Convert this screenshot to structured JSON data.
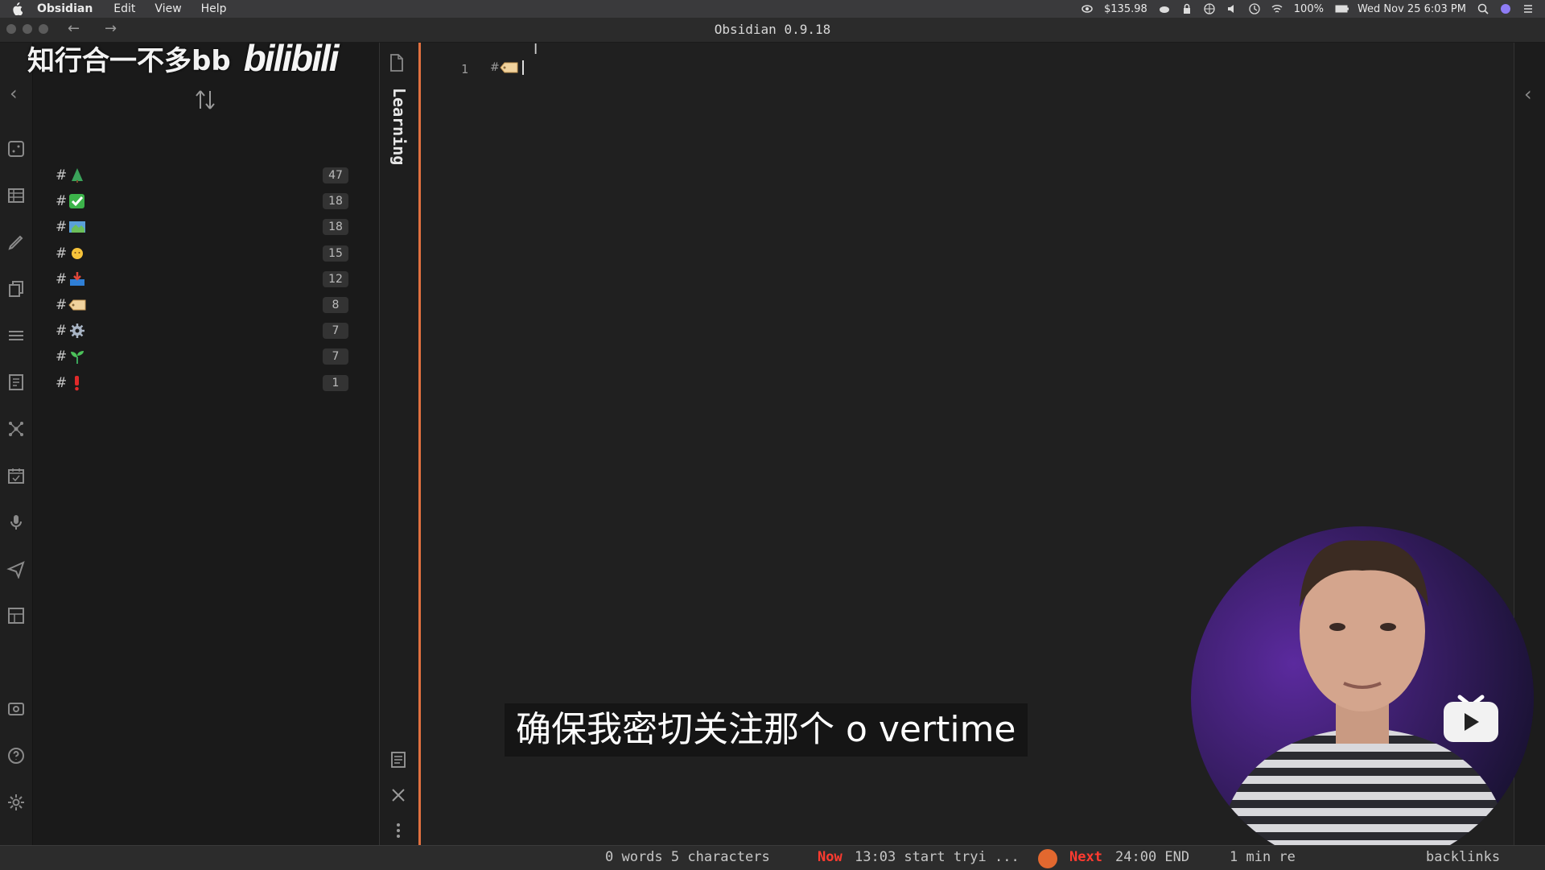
{
  "menubar": {
    "app": "Obsidian",
    "menus": [
      "Edit",
      "View",
      "Help"
    ],
    "price": "$135.98",
    "battery": "100%",
    "datetime": "Wed Nov 25  6:03 PM"
  },
  "window": {
    "title": "Obsidian 0.9.18"
  },
  "watermark": {
    "text": "知行合一不多bb",
    "logo": "bilibili"
  },
  "tags": [
    {
      "emoji": "tree-emoji",
      "count": "47"
    },
    {
      "emoji": "check-emoji",
      "count": "18"
    },
    {
      "emoji": "map-emoji",
      "count": "18"
    },
    {
      "emoji": "sun-emoji",
      "count": "15"
    },
    {
      "emoji": "inbox-emoji",
      "count": "12"
    },
    {
      "emoji": "label-emoji",
      "count": "8"
    },
    {
      "emoji": "gear-emoji",
      "count": "7"
    },
    {
      "emoji": "seedling-emoji",
      "count": "7"
    },
    {
      "emoji": "exclamation-emoji",
      "count": "1"
    }
  ],
  "tag_hash": "#",
  "strip": {
    "label": "Learning"
  },
  "editor": {
    "line_number": "1",
    "token": "#"
  },
  "status": {
    "words": "0 words 5 characters",
    "now_label": "Now",
    "now_text": "13:03 start tryi ...",
    "next_label": "Next",
    "next_text": "24:00 END",
    "read_time": "1 min re",
    "backlinks": "backlinks"
  },
  "subtitle": "确保我密切关注那个 o vertime",
  "colors": {
    "accent": "#e0703f",
    "status_red": "#ff3b30"
  }
}
